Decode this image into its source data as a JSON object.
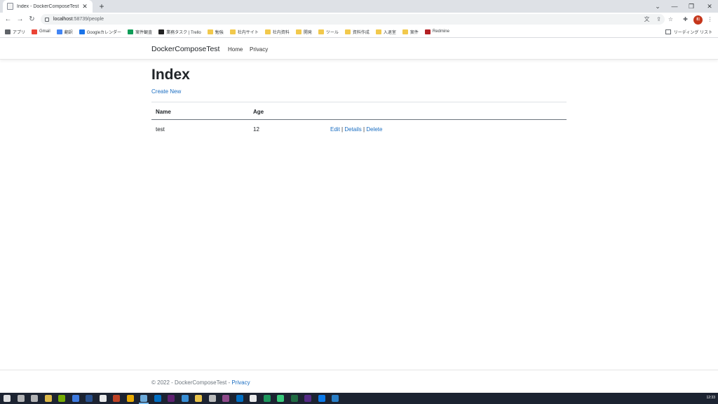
{
  "browser": {
    "tab_title": "Index - DockerComposeTest",
    "tab_close": "✕",
    "new_tab": "+",
    "url_host": "localhost",
    "url_path": ":58739/people",
    "bookmarks": [
      {
        "label": "アプリ",
        "color": "#5f6368"
      },
      {
        "label": "Gmail",
        "color": "#ea4335"
      },
      {
        "label": "翻訳",
        "color": "#4285f4"
      },
      {
        "label": "Googleカレンダー",
        "color": "#1a73e8"
      },
      {
        "label": "案件観査",
        "color": "#0f9d58"
      },
      {
        "label": "業務タスク | Trello",
        "color": "#222222"
      },
      {
        "label": "勉強",
        "color": "#f2c94c"
      },
      {
        "label": "社内サイト",
        "color": "#f2c94c"
      },
      {
        "label": "社内資料",
        "color": "#f2c94c"
      },
      {
        "label": "開発",
        "color": "#f2c94c"
      },
      {
        "label": "ツール",
        "color": "#f2c94c"
      },
      {
        "label": "資料作成",
        "color": "#f2c94c"
      },
      {
        "label": "入退室",
        "color": "#f2c94c"
      },
      {
        "label": "案件",
        "color": "#f2c94c"
      },
      {
        "label": "Redmine",
        "color": "#b32024"
      }
    ],
    "reading_list": "リーディング リスト",
    "profile_initials": "和"
  },
  "navbar": {
    "brand": "DockerComposeTest",
    "home": "Home",
    "privacy": "Privacy"
  },
  "main": {
    "heading": "Index",
    "create_new": "Create New",
    "table": {
      "headers": [
        "Name",
        "Age"
      ],
      "rows": [
        {
          "name": "test",
          "age": "12",
          "edit": "Edit",
          "details": "Details",
          "delete": "Delete"
        }
      ]
    },
    "separator": "|"
  },
  "footer": {
    "text": "© 2022 - DockerComposeTest - ",
    "privacy": "Privacy"
  },
  "taskbar": {
    "clock": "12:33",
    "accent": "#76b9ed"
  }
}
